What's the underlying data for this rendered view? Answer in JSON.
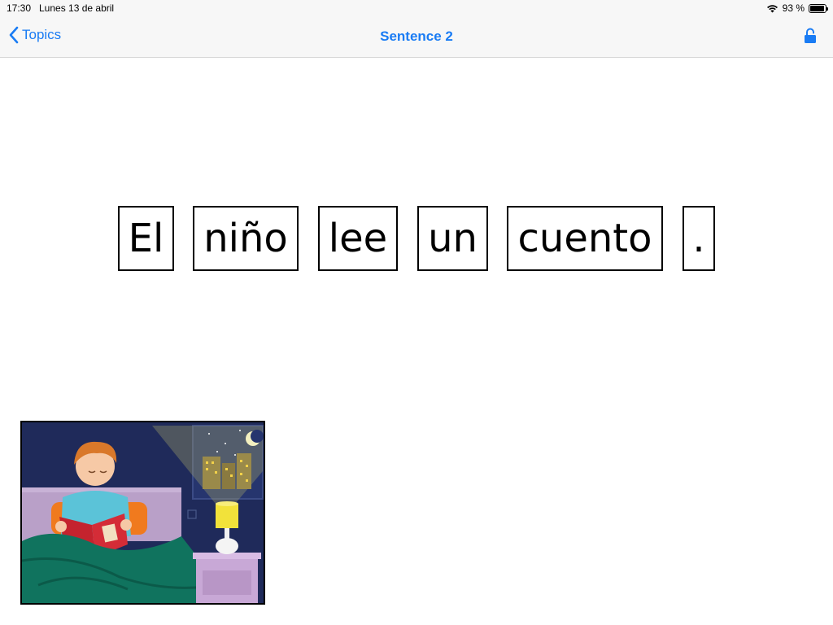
{
  "status_bar": {
    "time": "17:30",
    "date": "Lunes 13 de abril",
    "battery_text": "93 %",
    "battery_level": 0.93
  },
  "nav": {
    "back_label": "Topics",
    "title": "Sentence 2",
    "right_icon": "lock-open-icon"
  },
  "sentence": {
    "words": [
      "El",
      "niño",
      "lee",
      "un",
      "cuento",
      "."
    ]
  },
  "picture": {
    "icon": "boy-reading-in-bed-illustration"
  },
  "colors": {
    "accent": "#1a7cf4",
    "bar_background": "#f7f7f7"
  }
}
